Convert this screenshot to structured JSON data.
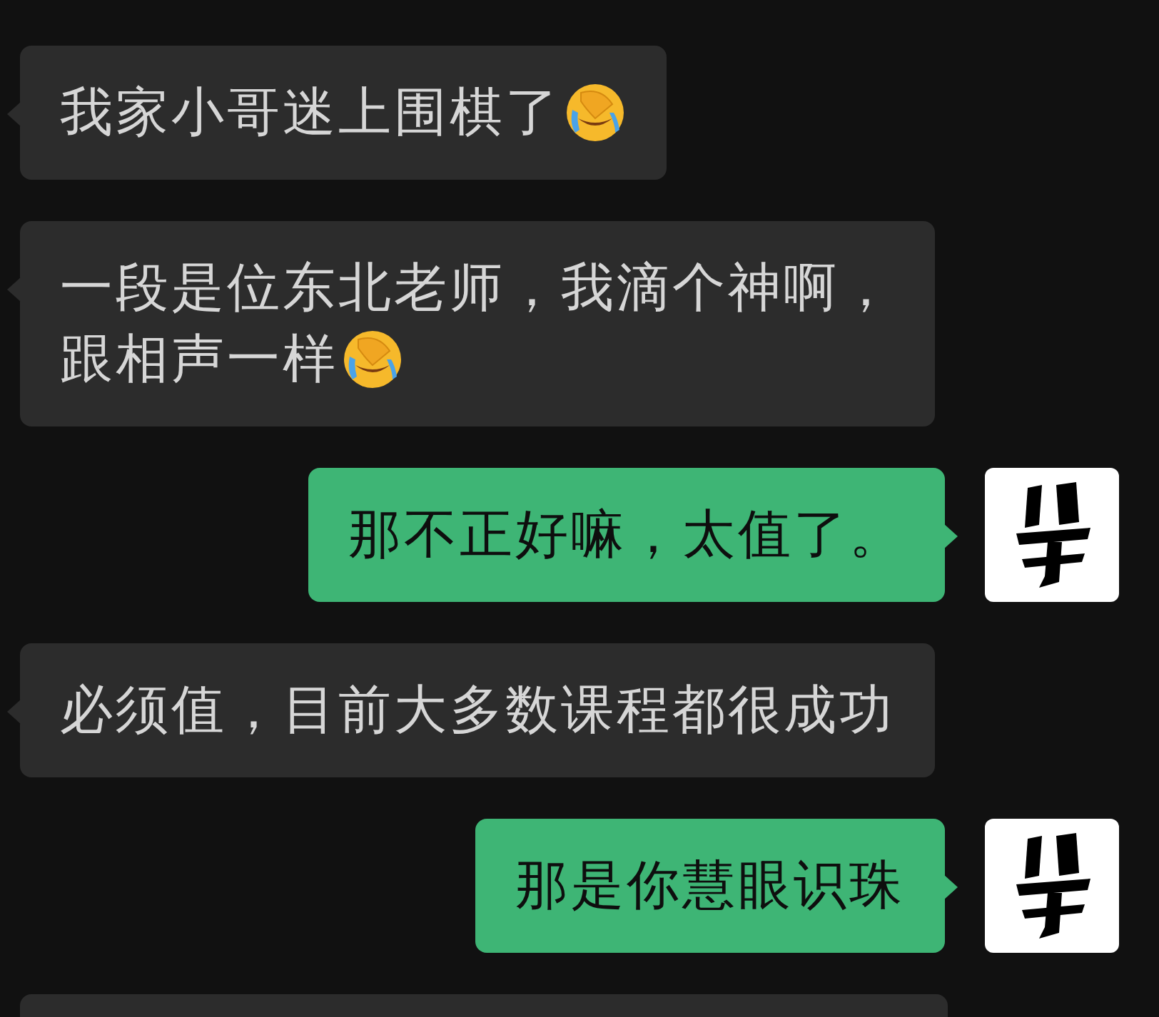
{
  "messages": [
    {
      "kind": "received",
      "lines": [
        "我家小哥迷上围棋了"
      ],
      "has_emoji": true
    },
    {
      "kind": "received",
      "lines": [
        "一段是位东北老师，我滴个神啊，",
        "跟相声一样"
      ],
      "has_emoji": true
    },
    {
      "kind": "sent",
      "lines": [
        "那不正好嘛，太值了。"
      ],
      "has_emoji": false
    },
    {
      "kind": "received",
      "lines": [
        "必须值，目前大多数课程都很成功"
      ],
      "has_emoji": false
    },
    {
      "kind": "sent",
      "lines": [
        "那是你慧眼识珠"
      ],
      "has_emoji": false
    },
    {
      "kind": "received_cut"
    }
  ]
}
